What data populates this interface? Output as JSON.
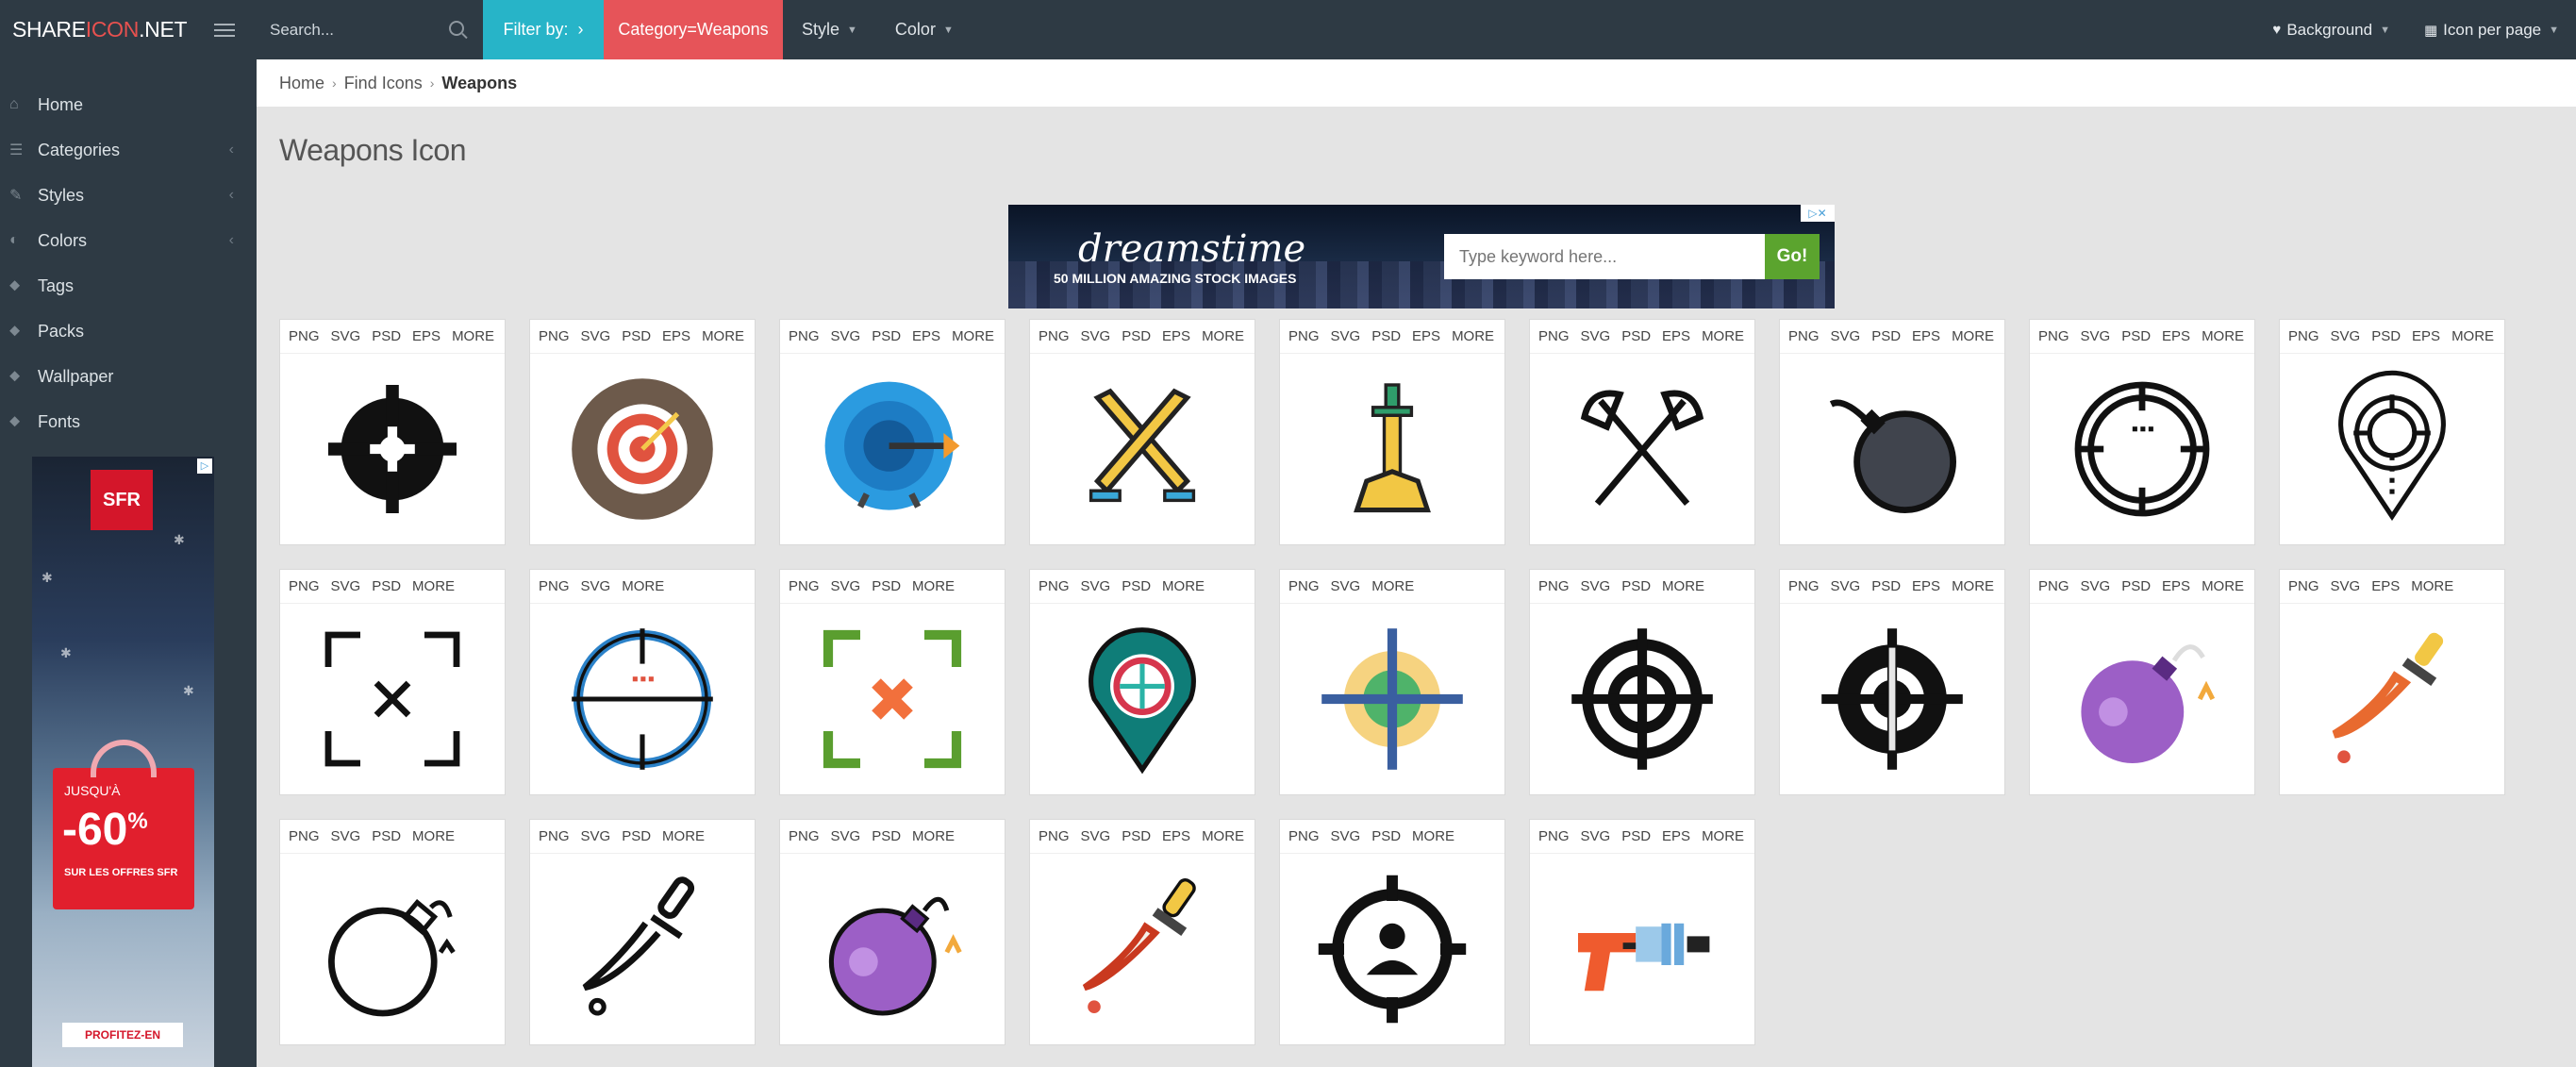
{
  "brand": {
    "part1": "SHARE",
    "part2": "ICON",
    "part3": ".NET"
  },
  "search": {
    "placeholder": "Search..."
  },
  "filter": {
    "label": "Filter by:",
    "arrow": "›",
    "category_chip": "Category=Weapons"
  },
  "menus": [
    {
      "label": "Style"
    },
    {
      "label": "Color"
    }
  ],
  "right_menu": {
    "background": "Background",
    "per_page": "Icon per page"
  },
  "sidebar": {
    "items": [
      {
        "label": "Home",
        "icon": "home-icon"
      },
      {
        "label": "Categories",
        "icon": "list-icon",
        "has_arrow": true
      },
      {
        "label": "Styles",
        "icon": "brush-icon",
        "has_arrow": true
      },
      {
        "label": "Colors",
        "icon": "palette-icon",
        "has_arrow": true
      },
      {
        "label": "Tags",
        "icon": "tags-icon"
      },
      {
        "label": "Packs",
        "icon": "packs-icon"
      },
      {
        "label": "Wallpaper",
        "icon": "wallpaper-icon"
      },
      {
        "label": "Fonts",
        "icon": "fonts-icon"
      }
    ]
  },
  "side_ad": {
    "brand": "SFR",
    "up_to": "JUSQU'À",
    "discount": "-60",
    "percent": "%",
    "offer": "SUR LES OFFRES SFR",
    "cta": "PROFITEZ-EN"
  },
  "breadcrumb": {
    "home": "Home",
    "find": "Find Icons",
    "current": "Weapons"
  },
  "page_title": "Weapons Icon",
  "top_ad": {
    "brand": "dreamstime",
    "tagline": "50 MILLION AMAZING STOCK IMAGES",
    "placeholder": "Type keyword here...",
    "go": "Go!"
  },
  "colors": {
    "topbar": "#2e3a44",
    "filter": "#27b4c8",
    "category": "#e65459",
    "go": "#5ba42e"
  },
  "icons": [
    {
      "name": "crosshair-black-icon",
      "formats": [
        "PNG",
        "SVG",
        "PSD",
        "EPS",
        "MORE"
      ]
    },
    {
      "name": "target-dartboard-icon",
      "formats": [
        "PNG",
        "SVG",
        "PSD",
        "EPS",
        "MORE"
      ]
    },
    {
      "name": "target-arrow-icon",
      "formats": [
        "PNG",
        "SVG",
        "PSD",
        "EPS",
        "MORE"
      ]
    },
    {
      "name": "crossed-swords-icon",
      "formats": [
        "PNG",
        "SVG",
        "PSD",
        "EPS",
        "MORE"
      ]
    },
    {
      "name": "sword-in-stone-icon",
      "formats": [
        "PNG",
        "SVG",
        "PSD",
        "EPS",
        "MORE"
      ]
    },
    {
      "name": "crossed-axes-icon",
      "formats": [
        "PNG",
        "SVG",
        "PSD",
        "EPS",
        "MORE"
      ]
    },
    {
      "name": "bomb-dark-icon",
      "formats": [
        "PNG",
        "SVG",
        "PSD",
        "EPS",
        "MORE"
      ]
    },
    {
      "name": "scope-outline-icon",
      "formats": [
        "PNG",
        "SVG",
        "PSD",
        "EPS",
        "MORE"
      ]
    },
    {
      "name": "location-target-icon",
      "formats": [
        "PNG",
        "SVG",
        "PSD",
        "EPS",
        "MORE"
      ]
    },
    {
      "name": "focus-frame-icon",
      "formats": [
        "PNG",
        "SVG",
        "PSD",
        "MORE"
      ]
    },
    {
      "name": "scope-blue-icon",
      "formats": [
        "PNG",
        "SVG",
        "MORE"
      ]
    },
    {
      "name": "focus-frame-color-icon",
      "formats": [
        "PNG",
        "SVG",
        "PSD",
        "MORE"
      ]
    },
    {
      "name": "location-target-color-icon",
      "formats": [
        "PNG",
        "SVG",
        "PSD",
        "MORE"
      ]
    },
    {
      "name": "crosshair-color-icon",
      "formats": [
        "PNG",
        "SVG",
        "MORE"
      ]
    },
    {
      "name": "crosshair-rings-icon",
      "formats": [
        "PNG",
        "SVG",
        "PSD",
        "MORE"
      ]
    },
    {
      "name": "crosshair-bold-icon",
      "formats": [
        "PNG",
        "SVG",
        "PSD",
        "EPS",
        "MORE"
      ]
    },
    {
      "name": "bomb-purple-icon",
      "formats": [
        "PNG",
        "SVG",
        "PSD",
        "EPS",
        "MORE"
      ]
    },
    {
      "name": "dagger-color-icon",
      "formats": [
        "PNG",
        "SVG",
        "EPS",
        "MORE"
      ]
    },
    {
      "name": "bomb-outline-icon",
      "formats": [
        "PNG",
        "SVG",
        "PSD",
        "MORE"
      ]
    },
    {
      "name": "dagger-outline-icon",
      "formats": [
        "PNG",
        "SVG",
        "PSD",
        "MORE"
      ]
    },
    {
      "name": "bomb-purple-outline-icon",
      "formats": [
        "PNG",
        "SVG",
        "PSD",
        "MORE"
      ]
    },
    {
      "name": "dagger-color-outline-icon",
      "formats": [
        "PNG",
        "SVG",
        "PSD",
        "EPS",
        "MORE"
      ]
    },
    {
      "name": "target-person-icon",
      "formats": [
        "PNG",
        "SVG",
        "PSD",
        "MORE"
      ]
    },
    {
      "name": "ray-gun-icon",
      "formats": [
        "PNG",
        "SVG",
        "PSD",
        "EPS",
        "MORE"
      ]
    }
  ]
}
